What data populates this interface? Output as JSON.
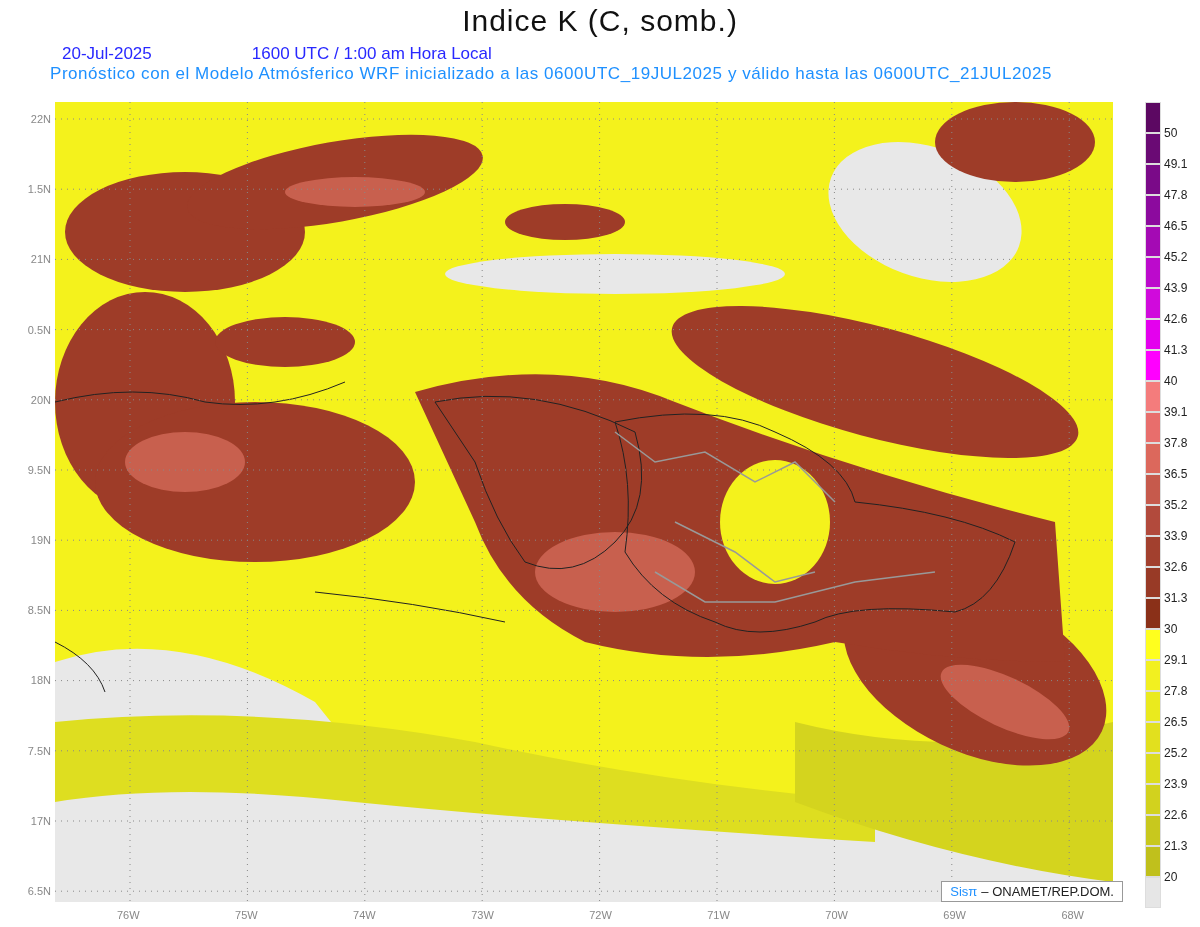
{
  "title": "Indice K (C, somb.)",
  "date": "20-Jul-2025",
  "time": "1600 UTC / 1:00 am Hora Local",
  "subtitle": "Pronóstico con el Modelo Atmósferico WRF inicializado a las 0600UTC_19JUL2025 y válido hasta las  0600UTC_21JUL2025",
  "lat_labels": [
    "22N",
    "1.5N",
    "21N",
    "0.5N",
    "20N",
    "9.5N",
    "19N",
    "8.5N",
    "18N",
    "7.5N",
    "17N",
    "6.5N"
  ],
  "lon_labels": [
    "76W",
    "75W",
    "74W",
    "73W",
    "72W",
    "71W",
    "70W",
    "69W",
    "68W"
  ],
  "colorbar": [
    {
      "label": "50",
      "color": "#5c0862"
    },
    {
      "label": "49.1",
      "color": "#6a0a74"
    },
    {
      "label": "47.8",
      "color": "#7a0a88"
    },
    {
      "label": "46.5",
      "color": "#8c0a9e"
    },
    {
      "label": "45.2",
      "color": "#a40ab4"
    },
    {
      "label": "43.9",
      "color": "#bc0acc"
    },
    {
      "label": "42.6",
      "color": "#d00adc"
    },
    {
      "label": "41.3",
      "color": "#e400ee"
    },
    {
      "label": "40",
      "color": "#ff00ff"
    },
    {
      "label": "39.1",
      "color": "#f47c7c"
    },
    {
      "label": "37.8",
      "color": "#e86e6c"
    },
    {
      "label": "36.5",
      "color": "#dc685c"
    },
    {
      "label": "35.2",
      "color": "#c65a4c"
    },
    {
      "label": "33.9",
      "color": "#b24a3c"
    },
    {
      "label": "32.6",
      "color": "#a2402e"
    },
    {
      "label": "31.3",
      "color": "#983a26"
    },
    {
      "label": "30",
      "color": "#8a3018"
    },
    {
      "label": "29.1",
      "color": "#ffff1e"
    },
    {
      "label": "27.8",
      "color": "#f2f020"
    },
    {
      "label": "26.5",
      "color": "#eaea1e"
    },
    {
      "label": "25.2",
      "color": "#e2e01e"
    },
    {
      "label": "23.9",
      "color": "#dcdc1e"
    },
    {
      "label": "22.6",
      "color": "#d2d21e"
    },
    {
      "label": "21.3",
      "color": "#c8c81e"
    },
    {
      "label": "20",
      "color": "#c0c01c"
    },
    {
      "color": "#e6e6e6"
    }
  ],
  "credit": {
    "brand": "Sisπ",
    "text": "– ONAMET/REP.DOM."
  }
}
